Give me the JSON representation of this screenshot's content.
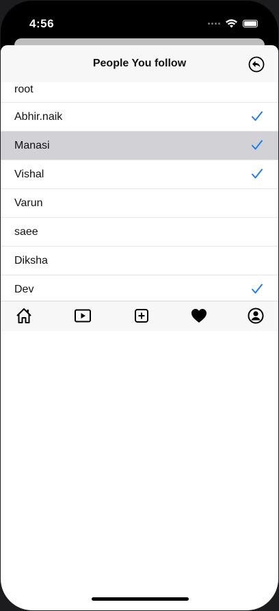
{
  "status_bar": {
    "time": "4:56"
  },
  "nav": {
    "title": "People You follow"
  },
  "people": [
    {
      "name": "root",
      "following": false,
      "selected": false
    },
    {
      "name": "Abhir.naik",
      "following": true,
      "selected": false
    },
    {
      "name": "Manasi",
      "following": true,
      "selected": true
    },
    {
      "name": "Vishal",
      "following": true,
      "selected": false
    },
    {
      "name": "Varun",
      "following": false,
      "selected": false
    },
    {
      "name": "saee",
      "following": false,
      "selected": false
    },
    {
      "name": "Diksha",
      "following": false,
      "selected": false
    },
    {
      "name": "Dev",
      "following": true,
      "selected": false
    }
  ],
  "tab_bar": {
    "tabs": [
      "home-icon",
      "play-video-icon",
      "add-post-icon",
      "heart-icon",
      "profile-icon"
    ]
  },
  "colors": {
    "accent": "#1e7cf2",
    "selected_row": "#d1d1d6"
  }
}
